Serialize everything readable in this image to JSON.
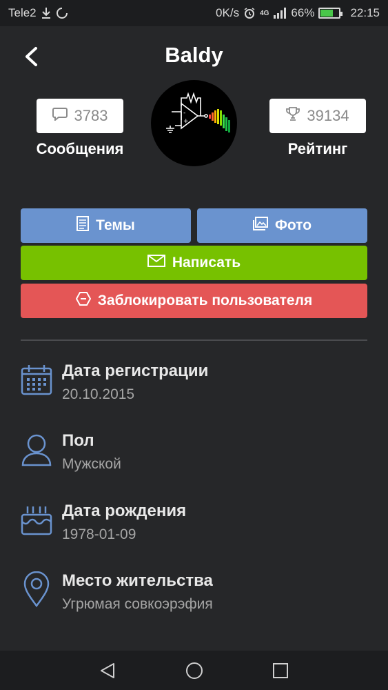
{
  "status_bar": {
    "carrier": "Tele2",
    "speed": "0K/s",
    "network": "4G",
    "battery": "66%",
    "battery_level": 0.66,
    "time": "22:15"
  },
  "header": {
    "title": "Baldy"
  },
  "stats": {
    "messages_count": "3783",
    "messages_label": "Сообщения",
    "rating_count": "39134",
    "rating_label": "Рейтинг"
  },
  "actions": {
    "topics_label": "Темы",
    "photo_label": "Фото",
    "write_label": "Написать",
    "block_label": "Заблокировать пользователя"
  },
  "info": [
    {
      "label": "Дата регистрации",
      "value": "20.10.2015",
      "icon": "calendar-icon"
    },
    {
      "label": "Пол",
      "value": "Мужской",
      "icon": "person-icon"
    },
    {
      "label": "Дата рождения",
      "value": "1978-01-09",
      "icon": "birthday-cake-icon"
    },
    {
      "label": "Место жительства",
      "value": "Угрюмая совкоэрэфия",
      "icon": "location-pin-icon"
    }
  ],
  "colors": {
    "background": "#262729",
    "blue_button": "#6a93cf",
    "green_button": "#77c100",
    "red_button": "#e45656",
    "icon_blue": "#6a93cf"
  }
}
